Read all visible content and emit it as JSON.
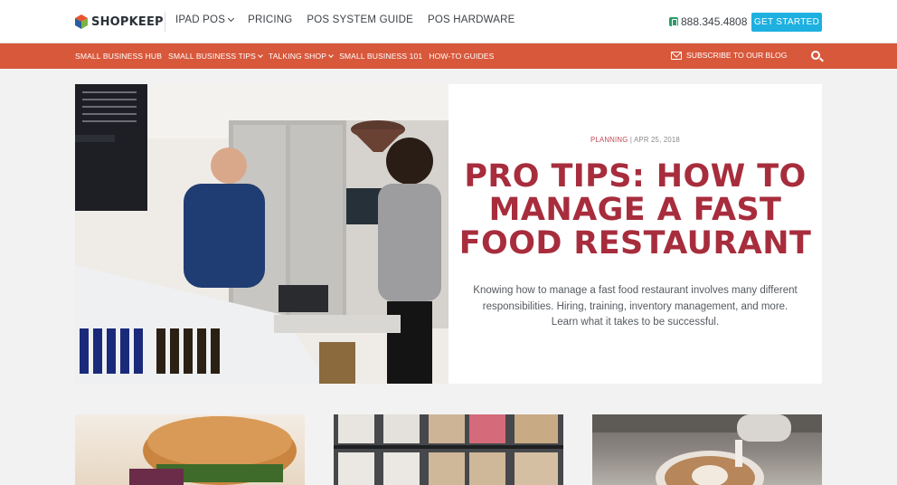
{
  "header": {
    "logo_text": "SHOPKEEP",
    "nav": [
      {
        "label": "IPAD POS",
        "has_dropdown": true
      },
      {
        "label": "PRICING",
        "has_dropdown": false
      },
      {
        "label": "POS SYSTEM GUIDE",
        "has_dropdown": false
      },
      {
        "label": "POS HARDWARE",
        "has_dropdown": false
      }
    ],
    "phone": "888.345.4808",
    "cta_label": "GET STARTED"
  },
  "subnav": {
    "items": [
      {
        "label": "SMALL BUSINESS HUB",
        "has_dropdown": false
      },
      {
        "label": "SMALL BUSINESS TIPS",
        "has_dropdown": true
      },
      {
        "label": "TALKING SHOP",
        "has_dropdown": true
      },
      {
        "label": "SMALL BUSINESS 101",
        "has_dropdown": false
      },
      {
        "label": "HOW-TO GUIDES",
        "has_dropdown": false
      }
    ],
    "subscribe_label": "SUBSCRIBE TO OUR BLOG"
  },
  "hero": {
    "category": "PLANNING",
    "separator": " | ",
    "date": "APR 25, 2018",
    "title": "PRO TIPS: HOW TO MANAGE A FAST FOOD RESTAURANT",
    "excerpt": "Knowing how to manage a fast food restaurant involves many different responsibilities. Hiring, training, inventory management, and more. Learn what it takes to be successful."
  },
  "colors": {
    "brand_orange": "#d8583b",
    "cta_blue": "#1db0e0",
    "headline_red": "#a72d3d",
    "phone_green": "#2d9c6a"
  }
}
